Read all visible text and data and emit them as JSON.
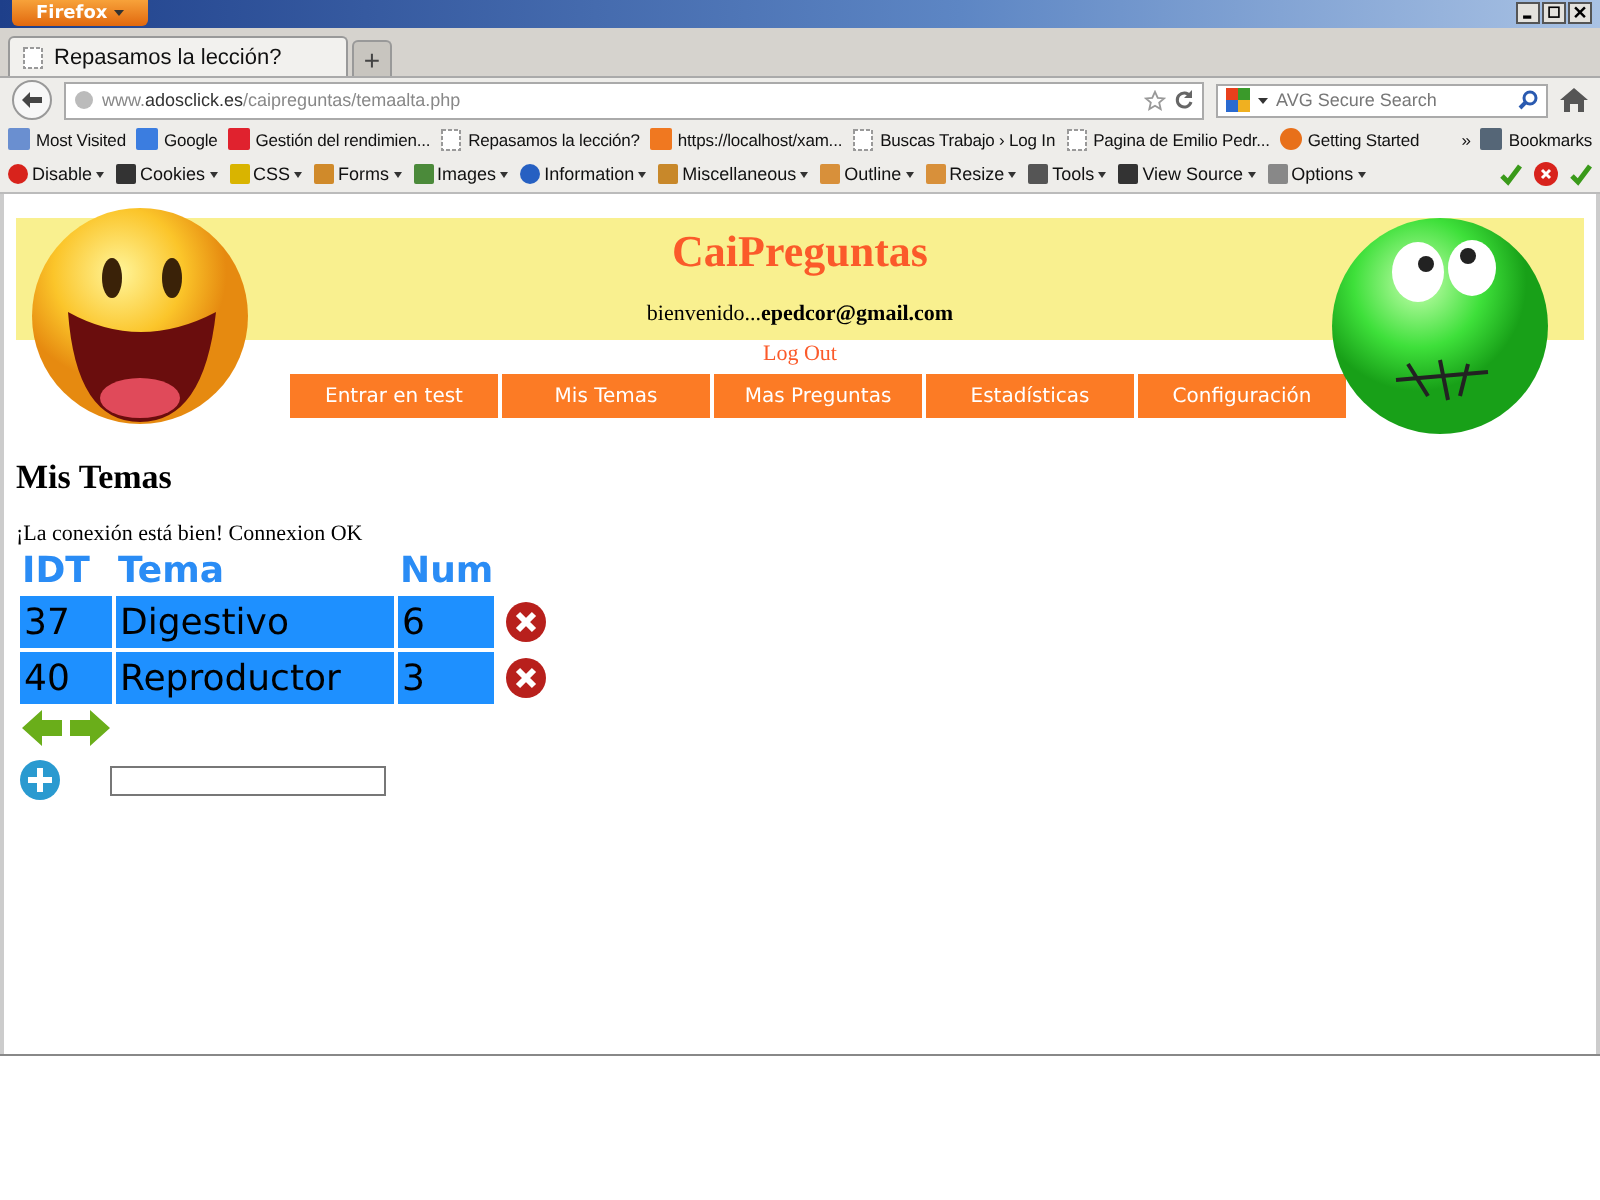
{
  "app_button": "Firefox",
  "tabs": [
    {
      "label": "Repasamos la lección?",
      "selected": true
    }
  ],
  "new_tab": "+",
  "url": {
    "prefix": "www.",
    "domain": "adosclick.es",
    "path": "/caipreguntas/temaalta.php"
  },
  "search": {
    "placeholder": "AVG Secure Search"
  },
  "bookmarks": [
    {
      "label": "Most Visited"
    },
    {
      "label": "Google"
    },
    {
      "label": "Gestión del rendimien..."
    },
    {
      "label": "Repasamos la lección?"
    },
    {
      "label": "https://localhost/xam..."
    },
    {
      "label": "Buscas Trabajo › Log In"
    },
    {
      "label": "Pagina de Emilio Pedr..."
    },
    {
      "label": "Getting Started"
    }
  ],
  "bookmarks_overflow": "»",
  "bookmarks_menu": "Bookmarks",
  "dev_toolbar": [
    {
      "label": "Disable"
    },
    {
      "label": "Cookies"
    },
    {
      "label": "CSS"
    },
    {
      "label": "Forms"
    },
    {
      "label": "Images"
    },
    {
      "label": "Information"
    },
    {
      "label": "Miscellaneous"
    },
    {
      "label": "Outline"
    },
    {
      "label": "Resize"
    },
    {
      "label": "Tools"
    },
    {
      "label": "View Source"
    },
    {
      "label": "Options"
    }
  ],
  "page": {
    "site_title": "CaiPreguntas",
    "welcome": "bienvenido...",
    "user_email": "epedcor@gmail.com",
    "logout": "Log Out",
    "nav": [
      {
        "label": "Entrar en test"
      },
      {
        "label": "Mis Temas"
      },
      {
        "label": "Mas Preguntas"
      },
      {
        "label": "Estadísticas"
      },
      {
        "label": "Configuración"
      }
    ],
    "heading": "Mis Temas",
    "status": "¡La conexión está bien! Connexion OK",
    "table": {
      "columns": [
        "IDT",
        "Tema",
        "Num"
      ],
      "rows": [
        [
          "37",
          "Digestivo",
          "6"
        ],
        [
          "40",
          "Reproductor",
          "3"
        ]
      ]
    }
  }
}
